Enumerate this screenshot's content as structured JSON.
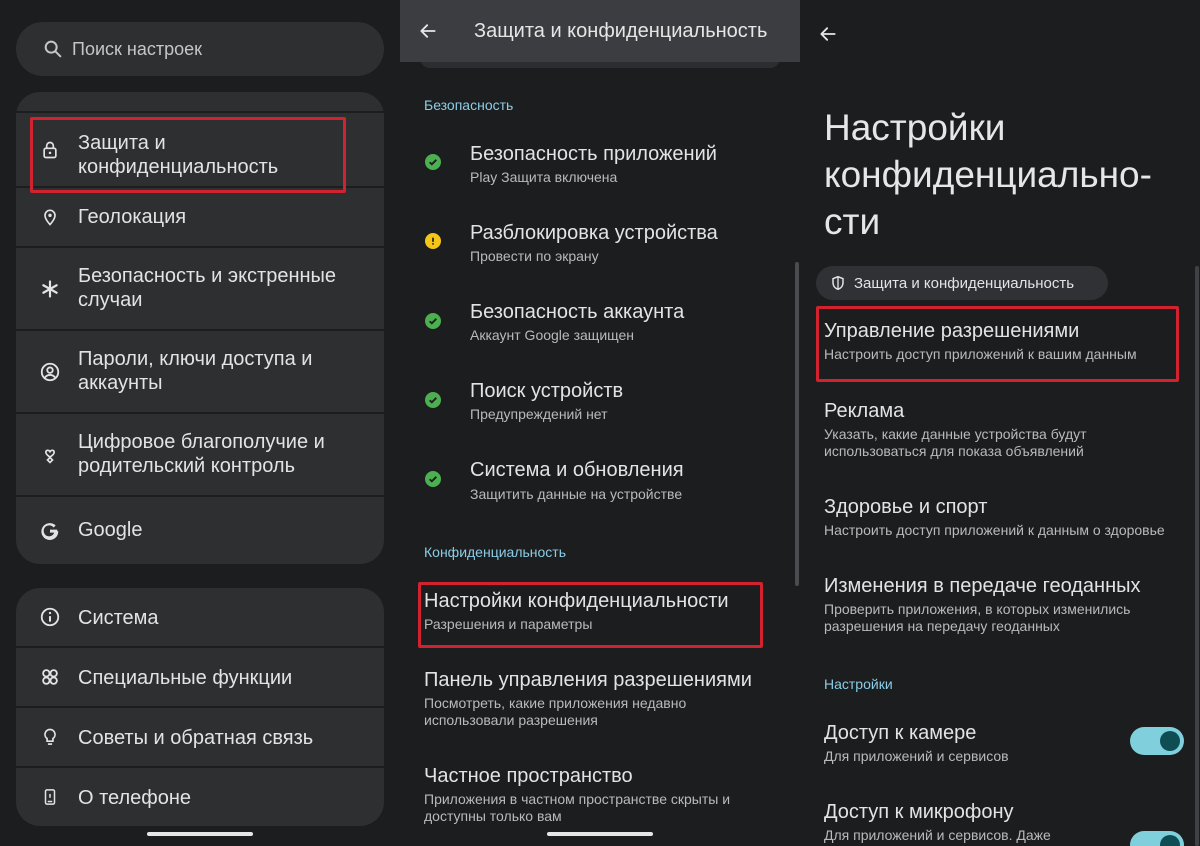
{
  "panel1": {
    "search_placeholder": "Поиск настроек",
    "items": [
      {
        "label": "Защита и конфиденциальность",
        "line1": "Защита и",
        "line2": "конфиденциальность",
        "icon": "lock-icon"
      },
      {
        "label": "Геолокация",
        "icon": "location-pin-icon"
      },
      {
        "label": "Безопасность и экстренные случаи",
        "line1": "Безопасность и экстренные",
        "line2": "случаи",
        "icon": "asterisk-icon"
      },
      {
        "label": "Пароли, ключи доступа и аккаунты",
        "line1": "Пароли, ключи доступа и",
        "line2": "аккаунты",
        "icon": "account-circle-icon"
      },
      {
        "label": "Цифровое благополучие и родительский контроль",
        "line1": "Цифровое благополучие и",
        "line2": "родительский контроль",
        "icon": "wellbeing-heart-icon"
      },
      {
        "label": "Google",
        "icon": "google-g-icon"
      }
    ],
    "items2": [
      {
        "label": "Система",
        "icon": "info-icon"
      },
      {
        "label": "Специальные функции",
        "icon": "accessibility-icon"
      },
      {
        "label": "Советы и обратная связь",
        "icon": "lightbulb-icon"
      },
      {
        "label": "О телефоне",
        "icon": "phone-icon"
      }
    ]
  },
  "panel2": {
    "title": "Защита и конфиденциальность",
    "section_security": "Безопасность",
    "security_items": [
      {
        "title": "Безопасность приложений",
        "subtitle": "Play Защита включена",
        "status": "ok"
      },
      {
        "title": "Разблокировка устройства",
        "subtitle": "Провести по экрану",
        "status": "warning"
      },
      {
        "title": "Безопасность аккаунта",
        "subtitle": "Аккаунт Google защищен",
        "status": "ok"
      },
      {
        "title": "Поиск устройств",
        "subtitle": "Предупреждений нет",
        "status": "ok"
      },
      {
        "title": "Система и обновления",
        "subtitle": "Защитить данные на устройстве",
        "status": "ok"
      }
    ],
    "section_privacy": "Конфиденциальность",
    "privacy_items": [
      {
        "title": "Настройки конфиденциальности",
        "subtitle": "Разрешения и параметры"
      },
      {
        "title": "Панель управления разрешениями",
        "subtitle": "Посмотреть, какие приложения недавно",
        "subtitle2": "использовали разрешения"
      },
      {
        "title": "Частное пространство",
        "subtitle": "Приложения в частном пространстве скрыты и",
        "subtitle2": "доступны только вам"
      }
    ]
  },
  "panel3": {
    "title_line1": "Настройки",
    "title_line2": "конфиденциально-",
    "title_line3": "сти",
    "chip": "Защита и конфиденциальность",
    "items": [
      {
        "title": "Управление разрешениями",
        "subtitle": "Настроить доступ приложений к вашим данным"
      },
      {
        "title": "Реклама",
        "subtitle": "Указать, какие данные устройства будут",
        "subtitle2": "использоваться для показа объявлений"
      },
      {
        "title": "Здоровье и спорт",
        "subtitle": "Настроить доступ приложений к данным о здоровье"
      },
      {
        "title": "Изменения в передаче геоданных",
        "subtitle": "Проверить приложения, в которых изменились",
        "subtitle2": "разрешения на передачу геоданных"
      }
    ],
    "section_settings": "Настройки",
    "toggles": [
      {
        "title": "Доступ к камере",
        "subtitle": "Для приложений и сервисов",
        "on": true
      },
      {
        "title": "Доступ к микрофону",
        "subtitle": "Для приложений и сервисов. Даже",
        "on": true
      }
    ]
  },
  "colors": {
    "highlight": "#d3222f",
    "accent": "#8bcce6",
    "ok": "#4caf50",
    "warning": "#f5c518"
  }
}
